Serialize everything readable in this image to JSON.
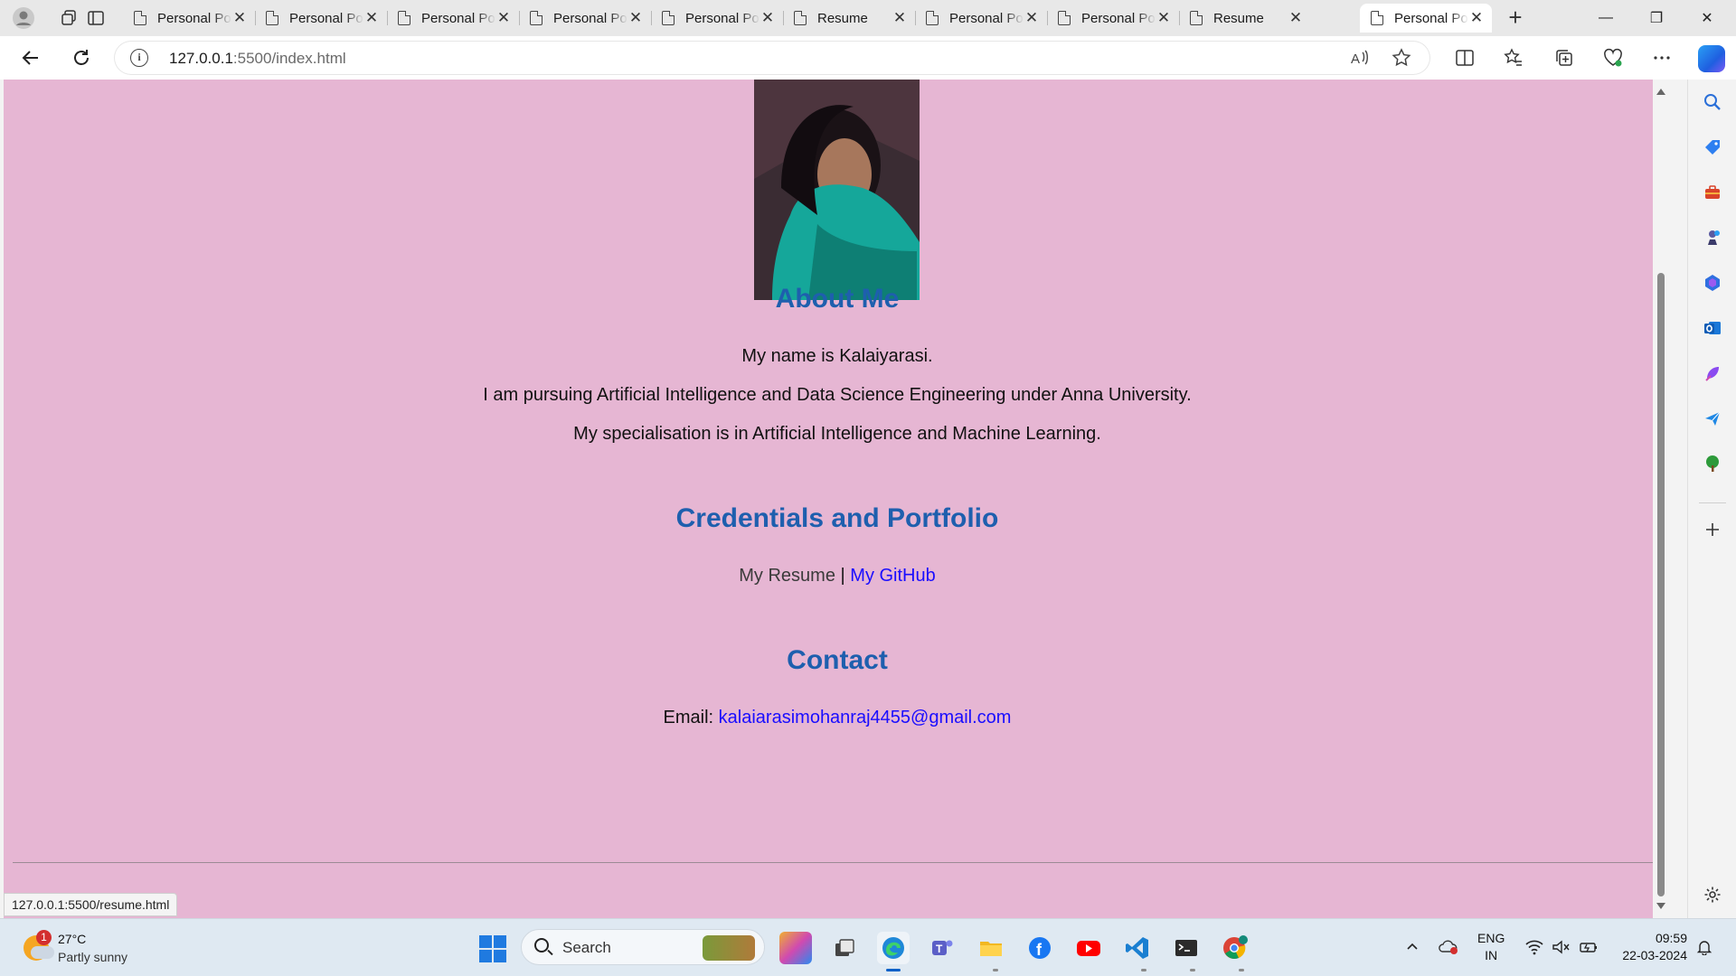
{
  "browser": {
    "tabs": [
      {
        "title": "Personal Portfolio",
        "active": false
      },
      {
        "title": "Personal Portfolio",
        "active": false
      },
      {
        "title": "Personal Portfolio",
        "active": false
      },
      {
        "title": "Personal Portfolio",
        "active": false
      },
      {
        "title": "Personal Portfolio",
        "active": false
      },
      {
        "title": "Resume",
        "active": false
      },
      {
        "title": "Personal Portfolio",
        "active": false
      },
      {
        "title": "Personal Portfolio",
        "active": false
      },
      {
        "title": "Resume",
        "active": false
      },
      {
        "title": "Personal Portfolio",
        "active": true
      }
    ],
    "tab_close_glyph": "✕",
    "new_tab_glyph": "+",
    "window_controls": {
      "minimize": "—",
      "maximize": "❐",
      "close": "✕"
    },
    "address": {
      "host": "127.0.0.1",
      "path": ":5500/index.html"
    },
    "status_url": "127.0.0.1:5500/resume.html"
  },
  "page": {
    "background_color": "#e6b6d3",
    "heading_color": "#1e5fae",
    "link_color": "#1a0dff",
    "about": {
      "title": "About Me",
      "lines": [
        "My name is Kalaiyarasi.",
        "I am pursuing Artificial Intelligence and Data Science Engineering under Anna University.",
        "My specialisation is in Artificial Intelligence and Machine Learning."
      ]
    },
    "credentials": {
      "title": "Credentials and Portfolio",
      "resume_label": "My Resume",
      "separator": "|",
      "github_label": "My GitHub"
    },
    "contact": {
      "title": "Contact",
      "email_label": "Email:",
      "email": "kalaiarasimohanraj4455@gmail.com"
    }
  },
  "taskbar": {
    "weather": {
      "temp": "27°C",
      "desc": "Partly sunny",
      "badge": "1"
    },
    "search_placeholder": "Search",
    "language": {
      "line1": "ENG",
      "line2": "IN"
    },
    "clock": {
      "time": "09:59",
      "date": "22-03-2024"
    }
  }
}
